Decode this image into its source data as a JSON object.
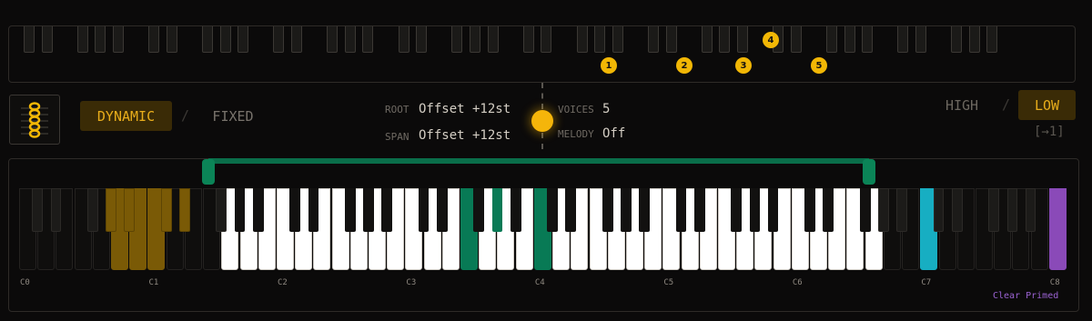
{
  "top_strip": {
    "badges": [
      "1",
      "2",
      "3",
      "4",
      "5"
    ]
  },
  "mode": {
    "dynamic_label": "DYNAMIC",
    "separator": "/",
    "fixed_label": "FIXED"
  },
  "params": {
    "root_label": "ROOT",
    "root_value": "Offset +12st",
    "span_label": "SPAN",
    "span_value": "Offset +12st",
    "voices_label": "VOICES",
    "voices_value": "5",
    "melody_label": "MELODY",
    "melody_value": "Off"
  },
  "priority": {
    "high_label": "HIGH",
    "separator": "/",
    "low_label": "LOW",
    "shortcut": "[→1]"
  },
  "keyboard": {
    "octave_labels": [
      "C0",
      "C1",
      "C2",
      "C3",
      "C4",
      "C5",
      "C6",
      "C7",
      "C8"
    ],
    "clear_primed_label": "Clear Primed",
    "colors": {
      "in_range": "#ffffff",
      "out_of_range": "#0f0e0d",
      "held": "#087a55",
      "low_zone": "#7a5a06",
      "cyan_marker": "#17aec2",
      "purple_marker": "#8a4ab8",
      "range_handle": "#0a7a52"
    }
  }
}
